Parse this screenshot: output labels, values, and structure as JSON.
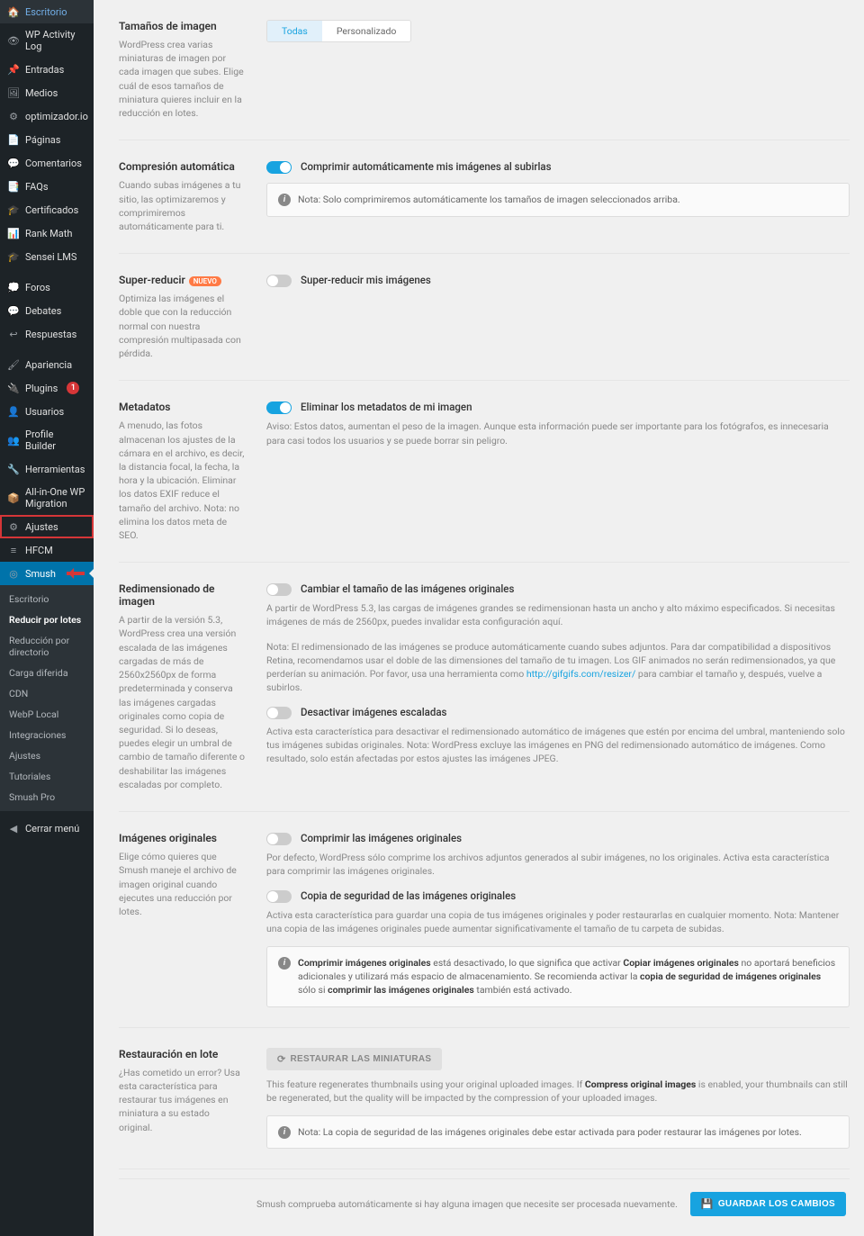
{
  "sidebar": {
    "items": [
      {
        "icon": "desktop",
        "label": "Escritorio"
      },
      {
        "icon": "activity",
        "label": "WP Activity Log"
      },
      {
        "icon": "pin",
        "label": "Entradas"
      },
      {
        "icon": "media",
        "label": "Medios"
      },
      {
        "icon": "opt",
        "label": "optimizador.io"
      },
      {
        "icon": "page",
        "label": "Páginas"
      },
      {
        "icon": "comment",
        "label": "Comentarios"
      },
      {
        "icon": "faq",
        "label": "FAQs"
      },
      {
        "icon": "cert",
        "label": "Certificados"
      },
      {
        "icon": "rank",
        "label": "Rank Math"
      },
      {
        "icon": "sensei",
        "label": "Sensei LMS"
      },
      {
        "icon": "forum",
        "label": "Foros"
      },
      {
        "icon": "debate",
        "label": "Debates"
      },
      {
        "icon": "reply",
        "label": "Respuestas"
      },
      {
        "icon": "appearance",
        "label": "Apariencia"
      },
      {
        "icon": "plugin",
        "label": "Plugins",
        "badge": "1"
      },
      {
        "icon": "users",
        "label": "Usuarios"
      },
      {
        "icon": "profile",
        "label": "Profile Builder"
      },
      {
        "icon": "tools",
        "label": "Herramientas"
      },
      {
        "icon": "migrate",
        "label": "All-in-One WP Migration"
      },
      {
        "icon": "settings",
        "label": "Ajustes",
        "highlight": true
      },
      {
        "icon": "hfcm",
        "label": "HFCM"
      },
      {
        "icon": "smush",
        "label": "Smush",
        "active": true,
        "arrow": true
      }
    ],
    "sub": [
      "Escritorio",
      "Reducir por lotes",
      "Reducción por directorio",
      "Carga diferida",
      "CDN",
      "WebP Local",
      "Integraciones",
      "Ajustes",
      "Tutoriales",
      "Smush Pro"
    ],
    "sub_selected": 1,
    "collapse": "Cerrar menú"
  },
  "sections": {
    "image_sizes": {
      "title": "Tamaños de imagen",
      "desc": "WordPress crea varias miniaturas de imagen por cada imagen que subes. Elige cuál de esos tamaños de miniatura quieres incluir en la reducción en lotes.",
      "tab_all": "Todas",
      "tab_custom": "Personalizado"
    },
    "auto_compress": {
      "title": "Compresión automática",
      "desc": "Cuando subas imágenes a tu sitio, las optimizaremos y comprimiremos automáticamente para ti.",
      "toggle_label": "Comprimir automáticamente mis imágenes al subirlas",
      "notice": "Nota: Solo comprimiremos automáticamente los tamaños de imagen seleccionados arriba."
    },
    "super_smush": {
      "title": "Super-reducir",
      "badge": "NUEVO",
      "desc": "Optimiza las imágenes el doble que con la reducción normal con nuestra compresión multipasada con pérdida.",
      "toggle_label": "Super-reducir mis imágenes"
    },
    "metadata": {
      "title": "Metadatos",
      "desc": "A menudo, las fotos almacenan los ajustes de la cámara en el archivo, es decir, la distancia focal, la fecha, la hora y la ubicación. Eliminar los datos EXIF reduce el tamaño del archivo. Nota: no elimina los datos meta de SEO.",
      "toggle_label": "Eliminar los metadatos de mi imagen",
      "toggle_desc": "Aviso: Estos datos, aumentan el peso de la imagen. Aunque esta información puede ser importante para los fotógrafos, es innecesaria para casi todos los usuarios y se puede borrar sin peligro."
    },
    "resize": {
      "title": "Redimensionado de imagen",
      "desc": "A partir de la versión 5.3, WordPress crea una versión escalada de las imágenes cargadas de más de 2560x2560px de forma predeterminada y conserva las imágenes cargadas originales como copia de seguridad. Si lo deseas, puedes elegir un umbral de cambio de tamaño diferente o deshabilitar las imágenes escaladas por completo.",
      "resize_label": "Cambiar el tamaño de las imágenes originales",
      "resize_desc1": "A partir de WordPress 5.3, las cargas de imágenes grandes se redimensionan hasta un ancho y alto máximo especificados. Si necesitas imágenes de más de 2560px, puedes invalidar esta configuración aquí.",
      "resize_desc2_pre": "Nota: El redimensionado de las imágenes se produce automáticamente cuando subes adjuntos. Para dar compatibilidad a dispositivos Retina, recomendamos usar el doble de las dimensiones del tamaño de tu imagen. Los GIF animados no serán redimensionados, ya que perderían su animación. Por favor, usa una herramienta como ",
      "resize_link": "http://gifgifs.com/resizer/",
      "resize_desc2_post": " para cambiar el tamaño y, después, vuelve a subirlos.",
      "disable_label": "Desactivar imágenes escaladas",
      "disable_desc": "Activa esta característica para desactivar el redimensionado automático de imágenes que estén por encima del umbral, manteniendo solo tus imágenes subidas originales. Nota: WordPress excluye las imágenes en PNG del redimensionado automático de imágenes. Como resultado, solo están afectadas por estos ajustes las imágenes JPEG."
    },
    "originals": {
      "title": "Imágenes originales",
      "desc": "Elige cómo quieres que Smush maneje el archivo de imagen original cuando ejecutes una reducción por lotes.",
      "compress_label": "Comprimir las imágenes originales",
      "compress_desc": "Por defecto, WordPress sólo comprime los archivos adjuntos generados al subir imágenes, no los originales. Activa esta característica para comprimir las imágenes originales.",
      "backup_label": "Copia de seguridad de las imágenes originales",
      "backup_desc": "Activa esta característica para guardar una copia de tus imágenes originales y poder restaurarlas en cualquier momento. Nota: Mantener una copia de las imágenes originales puede aumentar significativamente el tamaño de tu carpeta de subidas.",
      "notice_1a": "Comprimir imágenes originales",
      "notice_1b": " está desactivado, lo que significa que activar ",
      "notice_1c": "Copiar imágenes originales",
      "notice_1d": " no aportará beneficios adicionales y utilizará más espacio de almacenamiento. Se recomienda activar la ",
      "notice_1e": "copia de seguridad de imágenes originales",
      "notice_1f": " sólo si ",
      "notice_1g": "comprimir las imágenes originales",
      "notice_1h": " también está activado."
    },
    "restore": {
      "title": "Restauración en lote",
      "desc": "¿Has cometido un error? Usa esta característica para restaurar tus imágenes en miniatura a su estado original.",
      "button": "RESTAURAR LAS MINIATURAS",
      "info_pre": "This feature regenerates thumbnails using your original uploaded images. If ",
      "info_bold": "Compress original images",
      "info_post": " is enabled, your thumbnails can still be regenerated, but the quality will be impacted by the compression of your uploaded images.",
      "notice": "Nota: La copia de seguridad de las imágenes originales debe estar activada para poder restaurar las imágenes por lotes."
    }
  },
  "footer": {
    "msg": "Smush comprueba automáticamente si hay alguna imagen que necesite ser procesada nuevamente.",
    "save": "GUARDAR LOS CAMBIOS"
  }
}
